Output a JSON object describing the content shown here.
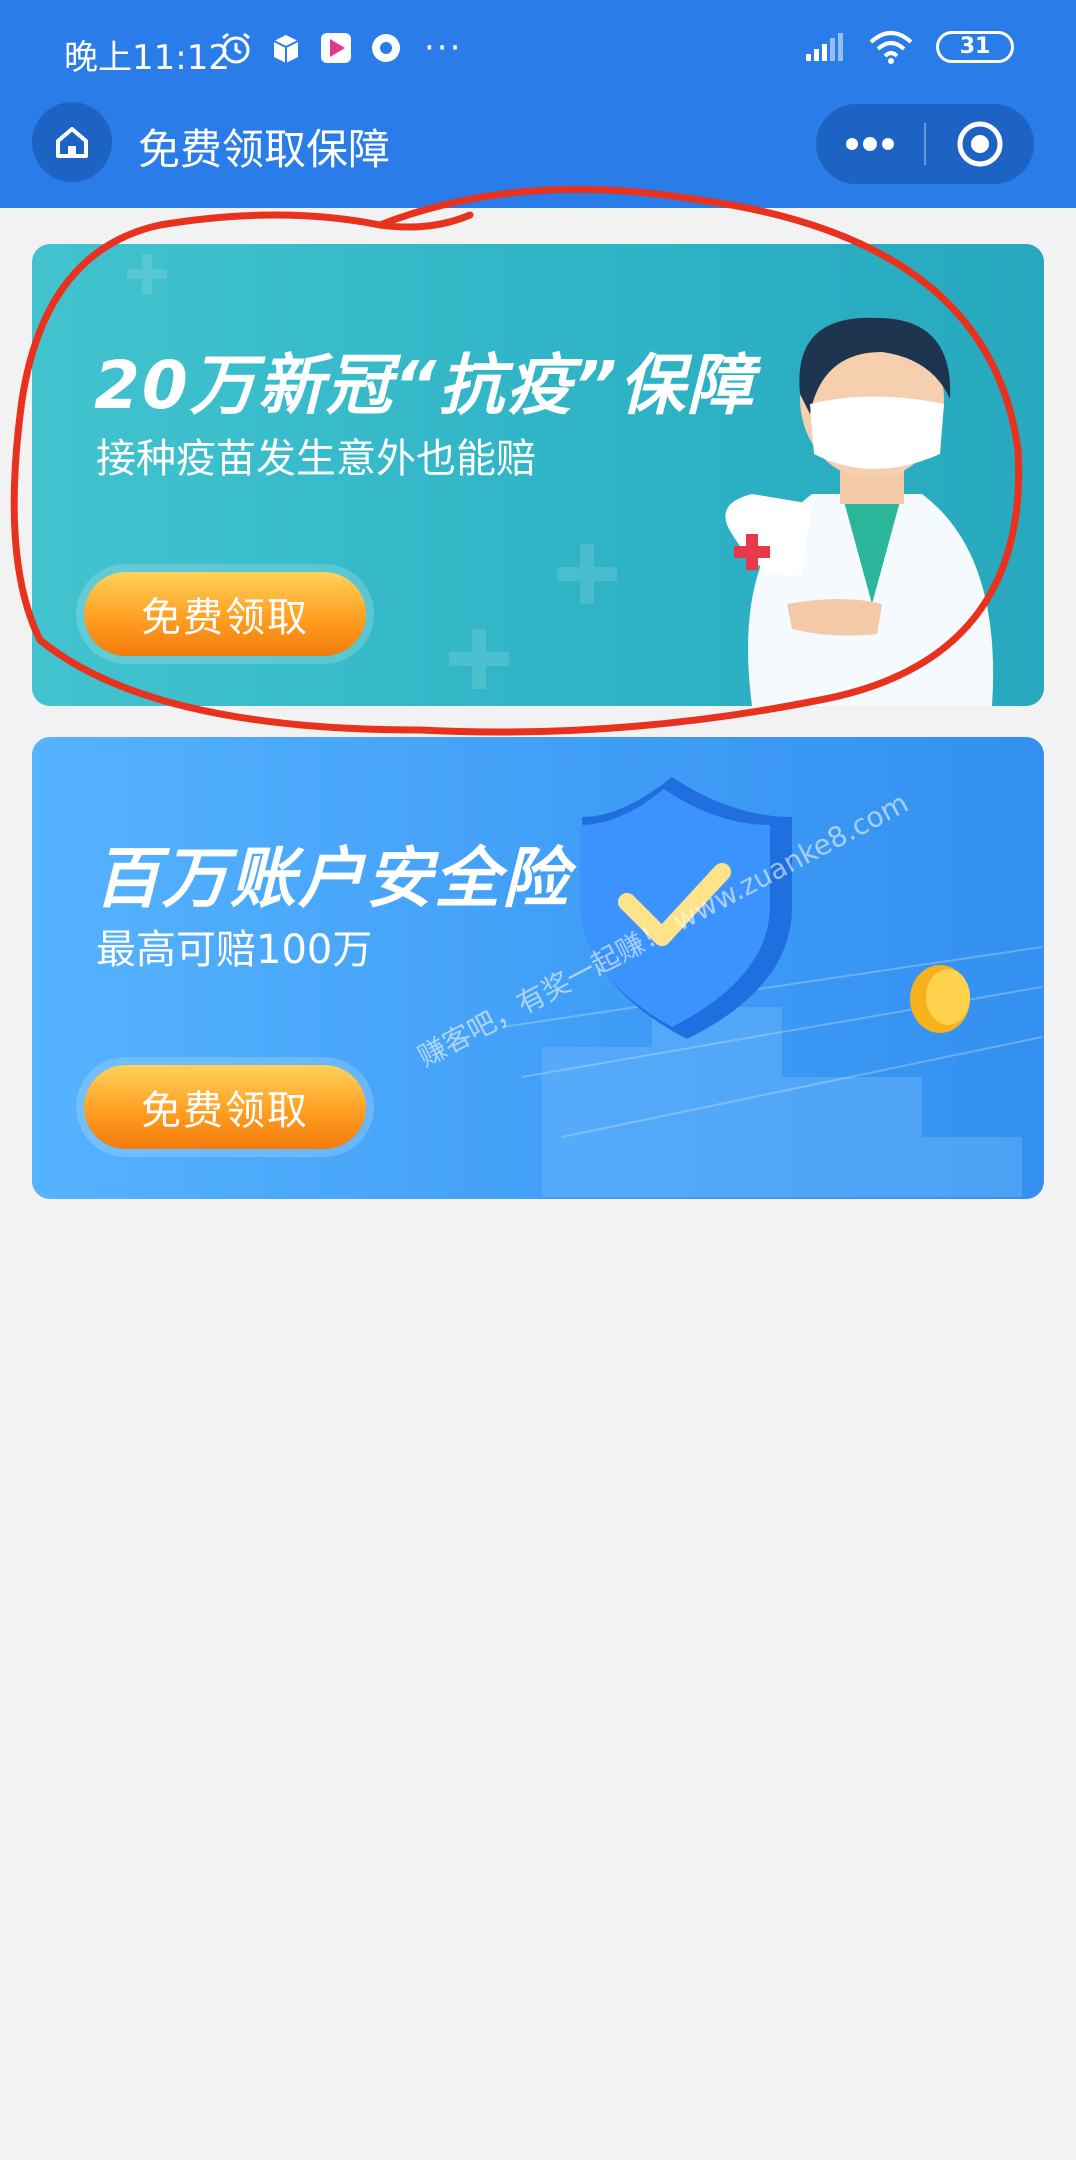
{
  "status_bar": {
    "time": "晚上11:12",
    "battery": "31",
    "more": "···"
  },
  "nav": {
    "title": "免费领取保障"
  },
  "cards": [
    {
      "title": "20万新冠“抗疫”保障",
      "subtitle": "接种疫苗发生意外也能赔",
      "button": "免费领取"
    },
    {
      "title": "百万账户安全险",
      "subtitle": "最高可赔100万",
      "button": "免费领取"
    }
  ],
  "watermark": "赚客吧，有奖一起赚！\nwww.zuanke8.com",
  "colors": {
    "header_blue": "#2a7de8",
    "card1_teal": "#35b8c9",
    "card2_blue": "#4aa7fb",
    "button_orange": "#ff9f22",
    "annotation_red": "#e8321e",
    "background": "#f2f2f2"
  }
}
